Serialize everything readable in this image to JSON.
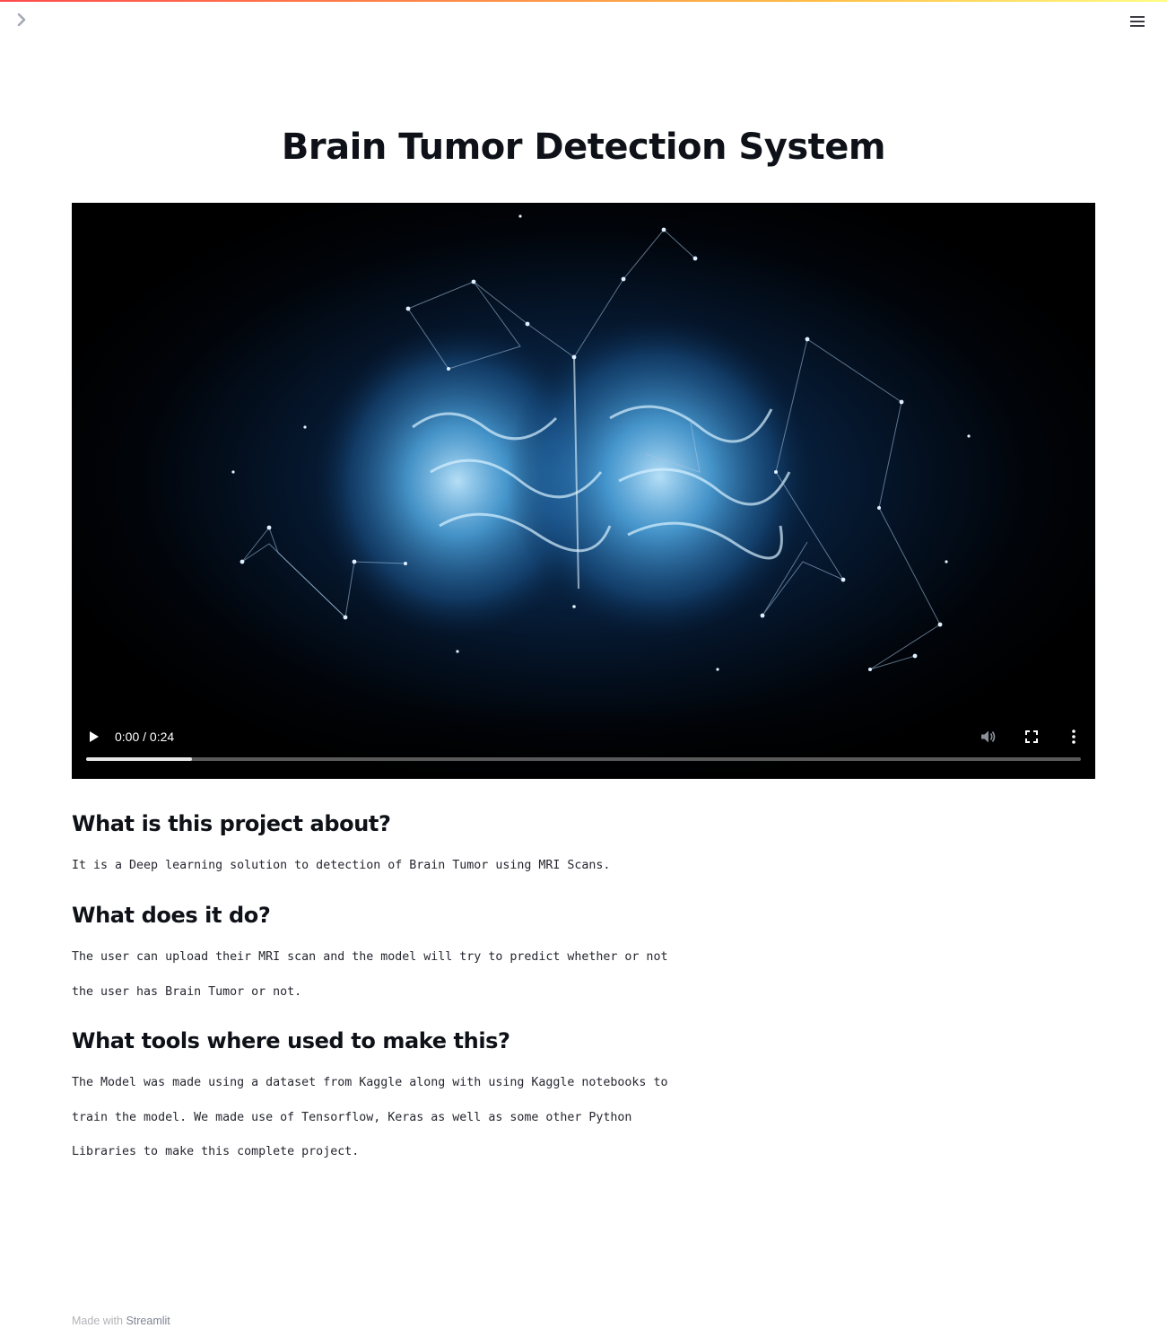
{
  "app": {
    "title": "Brain Tumor Detection System"
  },
  "video": {
    "time": "0:00 / 0:24",
    "progress_fraction": 0.106
  },
  "sections": [
    {
      "heading": "What is this project about?",
      "body": "It is a Deep learning solution to detection of Brain Tumor using MRI Scans."
    },
    {
      "heading": "What does it do?",
      "body": "The user can upload their MRI scan and the model will try to predict whether or not\nthe user has Brain Tumor or not."
    },
    {
      "heading": "What tools where used to make this?",
      "body": "The Model was made using a dataset from Kaggle along with using Kaggle notebooks to\ntrain the model. We made use of Tensorflow, Keras as well as some other Python\nLibraries to make this complete project."
    }
  ],
  "footer": {
    "prefix": "Made with ",
    "brand": "Streamlit"
  },
  "icons": {
    "sidebar_toggle": "chevron-right-icon",
    "menu": "hamburger-menu-icon",
    "play": "play-icon",
    "mute": "volume-icon",
    "fullscreen": "fullscreen-icon",
    "more": "more-vertical-icon"
  },
  "colors": {
    "accent_start": "#ff4b4b",
    "accent_end": "#fffd80",
    "text": "#262730",
    "heading": "#0e1117",
    "footer_muted": "#b3b3b8"
  }
}
